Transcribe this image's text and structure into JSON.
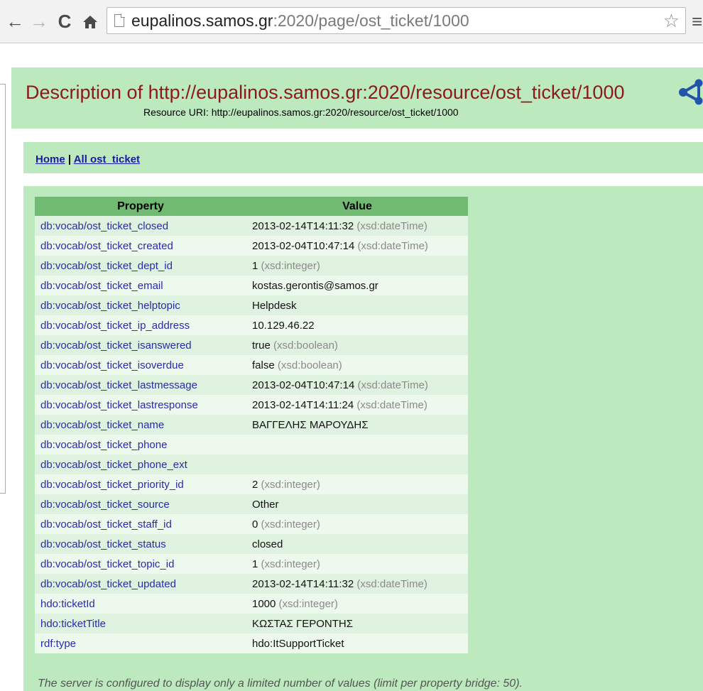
{
  "browser": {
    "url_host": "eupalinos.samos.gr",
    "url_rest": ":2020/page/ost_ticket/1000",
    "back": "←",
    "forward": "→",
    "reload": "C",
    "home": "⌂",
    "star": "☆",
    "menu": "≡"
  },
  "header": {
    "title": "Description of http://eupalinos.samos.gr:2020/resource/ost_ticket/1000",
    "resource_uri": "Resource URI: http://eupalinos.samos.gr:2020/resource/ost_ticket/1000"
  },
  "nav": {
    "home": "Home",
    "separator": "|",
    "all": "All ost_ticket"
  },
  "table": {
    "headers": [
      "Property",
      "Value"
    ],
    "rows": [
      {
        "property": "db:vocab/ost_ticket_closed",
        "value": "2013-02-14T14:11:32",
        "type": "(xsd:dateTime)"
      },
      {
        "property": "db:vocab/ost_ticket_created",
        "value": "2013-02-04T10:47:14",
        "type": "(xsd:dateTime)"
      },
      {
        "property": "db:vocab/ost_ticket_dept_id",
        "value": "1",
        "type": "(xsd:integer)"
      },
      {
        "property": "db:vocab/ost_ticket_email",
        "value": "kostas.gerontis@samos.gr",
        "type": ""
      },
      {
        "property": "db:vocab/ost_ticket_helptopic",
        "value": "Helpdesk",
        "type": ""
      },
      {
        "property": "db:vocab/ost_ticket_ip_address",
        "value": "10.129.46.22",
        "type": ""
      },
      {
        "property": "db:vocab/ost_ticket_isanswered",
        "value": "true",
        "type": "(xsd:boolean)"
      },
      {
        "property": "db:vocab/ost_ticket_isoverdue",
        "value": "false",
        "type": "(xsd:boolean)"
      },
      {
        "property": "db:vocab/ost_ticket_lastmessage",
        "value": "2013-02-04T10:47:14",
        "type": "(xsd:dateTime)"
      },
      {
        "property": "db:vocab/ost_ticket_lastresponse",
        "value": "2013-02-14T14:11:24",
        "type": "(xsd:dateTime)"
      },
      {
        "property": "db:vocab/ost_ticket_name",
        "value": "ΒΑΓΓΕΛΗΣ ΜΑΡΟΥΔΗΣ",
        "type": ""
      },
      {
        "property": "db:vocab/ost_ticket_phone",
        "value": "",
        "type": ""
      },
      {
        "property": "db:vocab/ost_ticket_phone_ext",
        "value": "",
        "type": ""
      },
      {
        "property": "db:vocab/ost_ticket_priority_id",
        "value": "2",
        "type": "(xsd:integer)"
      },
      {
        "property": "db:vocab/ost_ticket_source",
        "value": "Other",
        "type": ""
      },
      {
        "property": "db:vocab/ost_ticket_staff_id",
        "value": "0",
        "type": "(xsd:integer)"
      },
      {
        "property": "db:vocab/ost_ticket_status",
        "value": "closed",
        "type": ""
      },
      {
        "property": "db:vocab/ost_ticket_topic_id",
        "value": "1",
        "type": "(xsd:integer)"
      },
      {
        "property": "db:vocab/ost_ticket_updated",
        "value": "2013-02-14T14:11:32",
        "type": "(xsd:dateTime)"
      },
      {
        "property": "hdo:ticketId",
        "value": "1000",
        "type": "(xsd:integer)"
      },
      {
        "property": "hdo:ticketTitle",
        "value": "ΚΩΣΤΑΣ ΓΕΡΟΝΤΗΣ",
        "type": ""
      },
      {
        "property": "rdf:type",
        "value": "hdo:ItSupportTicket",
        "type": ""
      }
    ]
  },
  "footer": {
    "note": "The server is configured to display only a limited number of values (limit per property bridge: 50)."
  },
  "colors": {
    "panel_bg": "#bde9be",
    "header_row": "#70ba72",
    "title_color": "#8b1a1a",
    "link_color": "#2a2aaa"
  }
}
